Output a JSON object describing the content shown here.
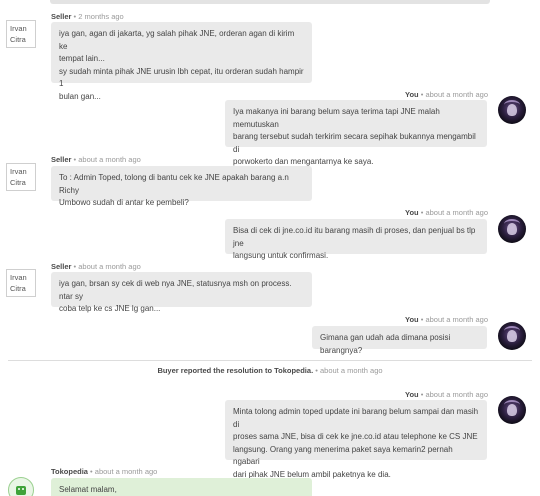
{
  "conversation": [
    {
      "sender": "Seller",
      "time": "2 months ago",
      "name_label": [
        "Irvan",
        "Citra"
      ],
      "lines": [
        "iya gan, agan di jakarta, yg salah pihak JNE, orderan agan di kirim ke",
        "tempat lain...",
        "sy sudah minta pihak JNE urusin lbh cepat, itu orderan sudah hampir 1",
        "bulan gan..."
      ]
    },
    {
      "sender": "You",
      "time": "about a month ago",
      "lines": [
        "Iya makanya ini barang belum saya terima tapi JNE malah memutuskan",
        "barang tersebut sudah terkirim secara sepihak bukannya mengambil di",
        "porwokerto dan mengantarnya ke saya."
      ]
    },
    {
      "sender": "Seller",
      "time": "about a month ago",
      "name_label": [
        "Irvan",
        "Citra"
      ],
      "lines": [
        "To : Admin Toped, tolong di bantu cek ke JNE apakah barang a.n Richy",
        "Umbowo sudah di antar ke pembeli?"
      ]
    },
    {
      "sender": "You",
      "time": "about a month ago",
      "lines": [
        "Bisa di cek di jne.co.id itu barang masih di proses, dan penjual bs tlp jne",
        "langsung untuk confirmasi."
      ]
    },
    {
      "sender": "Seller",
      "time": "about a month ago",
      "name_label": [
        "Irvan",
        "Citra"
      ],
      "lines": [
        "iya gan, brsan sy cek di web nya JNE, statusnya msh on process. ntar sy",
        "coba telp ke cs JNE lg gan..."
      ]
    },
    {
      "sender": "You",
      "time": "about a month ago",
      "lines": [
        "Gimana gan udah ada dimana posisi barangnya?"
      ]
    },
    {
      "sender": "You",
      "time": "about a month ago",
      "lines": [
        "Minta tolong admin toped update ini barang belum sampai dan masih di",
        "proses sama JNE, bisa di cek ke jne.co.id atau telephone ke CS JNE",
        "langsung. Orang yang menerima paket saya kemarin2 pernah ngabari",
        "dari pihak JNE belum ambil paketnya ke dia."
      ]
    },
    {
      "sender": "Tokopedia",
      "time": "about a month ago",
      "lines": [
        "Selamat malam,"
      ]
    }
  ],
  "system_event": {
    "text": "Buyer reported the resolution to Tokopedia.",
    "time": "about a month ago"
  },
  "separator": "•",
  "colors": {
    "bubble_gray": "#eaeaea",
    "bubble_green": "#dff0d8",
    "meta_gray": "#9a9a9a"
  },
  "icons": {
    "you_avatar": "dark-purple-character-avatar",
    "tokopedia_avatar": "tokopedia-owl-logo"
  }
}
